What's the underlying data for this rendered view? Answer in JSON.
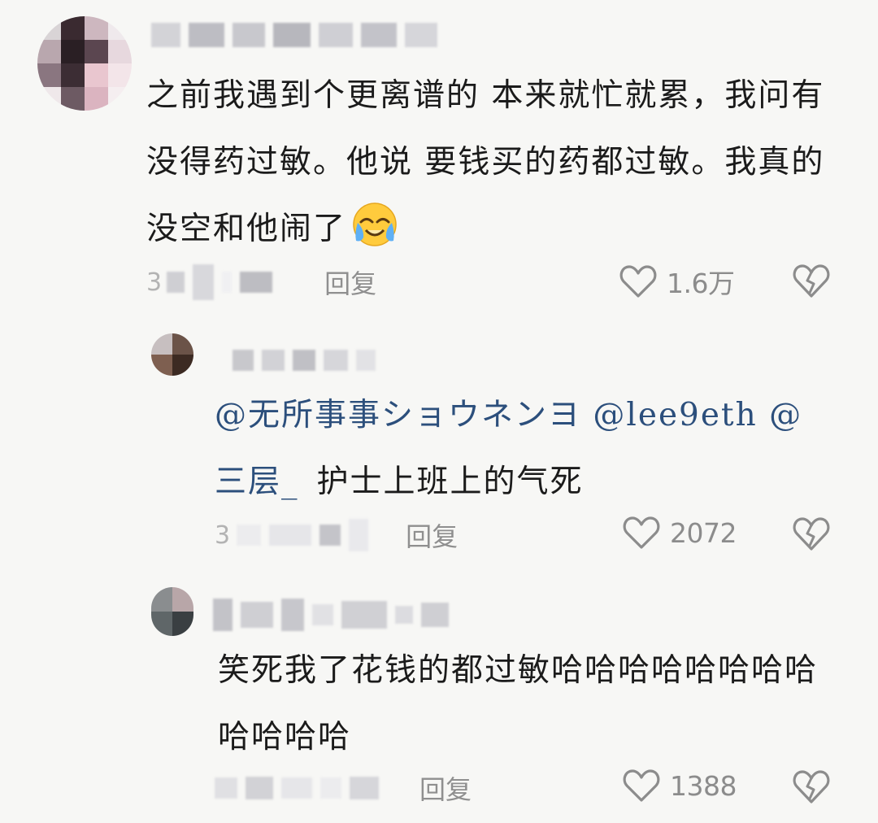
{
  "comments": [
    {
      "text": "之前我遇到个更离谱的 本来就忙就累，我问有没得药过敏。他说 要钱买的药都过敏。我真的没空和他闹了",
      "emoji": "crying-laughing-face",
      "time_visible": "3",
      "reply_label": "回复",
      "like_count": "1.6万"
    },
    {
      "mention_text": "@无所事事ショウネンヨ @lee9eth @三层_",
      "text": "护士上班上的气死",
      "time_visible": "3",
      "reply_label": "回复",
      "like_count": "2072"
    },
    {
      "text": "笑死我了花钱的都过敏哈哈哈哈哈哈哈哈哈哈哈哈",
      "reply_label": "回复",
      "like_count": "1388"
    }
  ],
  "colors": {
    "background": "#f7f7f5",
    "mention": "#2c4f7c",
    "meta_text": "#b3b3b3",
    "icon_gray": "#8c8c8c"
  },
  "icons": [
    "heart-icon",
    "broken-heart-icon",
    "crying-laughing-emoji"
  ]
}
